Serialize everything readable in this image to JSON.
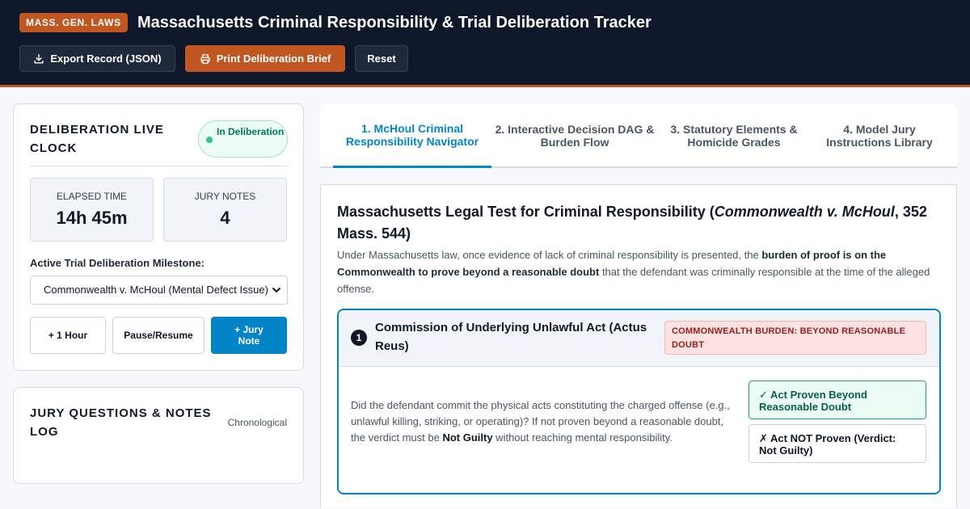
{
  "header": {
    "badge": "MASS. GEN. LAWS",
    "title": "Massachusetts Criminal Responsibility & Trial Deliberation Tracker",
    "export_label": "Export Record (JSON)",
    "print_label": "Print Deliberation Brief",
    "reset_label": "Reset"
  },
  "clock": {
    "heading": "DELIBERATION LIVE CLOCK",
    "status": "In Deliberation",
    "elapsed_label": "ELAPSED TIME",
    "elapsed_value": "14h 45m",
    "notes_label": "JURY NOTES",
    "notes_value": "4",
    "milestone_label": "Active Trial Deliberation Milestone:",
    "milestone_selected": "Commonwealth v. McHoul (Mental Defect Issue)",
    "add_hour_label": "+ 1 Hour",
    "pause_label": "Pause/Resume",
    "add_note_label": "+ Jury Note"
  },
  "notes": {
    "heading": "JURY QUESTIONS & NOTES LOG",
    "sort": "Chronological"
  },
  "tabs": [
    {
      "label": "1. McHoul Criminal Responsibility Navigator",
      "active": true
    },
    {
      "label": "2. Interactive Decision DAG & Burden Flow",
      "active": false
    },
    {
      "label": "3. Statutory Elements & Homicide Grades",
      "active": false
    },
    {
      "label": "4. Model Jury Instructions Library",
      "active": false
    }
  ],
  "main": {
    "title_pre": "Massachusetts Legal Test for Criminal Responsibility (",
    "title_case": "Commonwealth v. McHoul",
    "title_post": ", 352 Mass. 544)",
    "intro_pre": "Under Massachusetts law, once evidence of lack of criminal responsibility is presented, the ",
    "intro_bold": "burden of proof is on the Commonwealth to prove beyond a reasonable doubt",
    "intro_post": " that the defendant was criminally responsible at the time of the alleged offense."
  },
  "element": {
    "number": "1",
    "title": "Commission of Underlying Unlawful Act (Actus Reus)",
    "burden": "COMMONWEALTH BURDEN: BEYOND REASONABLE DOUBT",
    "question_pre": "Did the defendant commit the physical acts constituting the charged offense (e.g., unlawful killing, striking, or operating)? If not proven beyond a reasonable doubt, the verdict must be ",
    "question_bold": "Not Guilty",
    "question_post": " without reaching mental responsibility.",
    "option_yes": "✓ Act Proven Beyond Reasonable Doubt",
    "option_no": "✗ Act NOT Proven (Verdict: Not Guilty)"
  },
  "colors": {
    "header_bg": "#0f172a",
    "accent_orange": "#c05621",
    "accent_blue": "#0284c7",
    "success_green": "#22a06b",
    "danger_red": "#9b1c1c"
  }
}
